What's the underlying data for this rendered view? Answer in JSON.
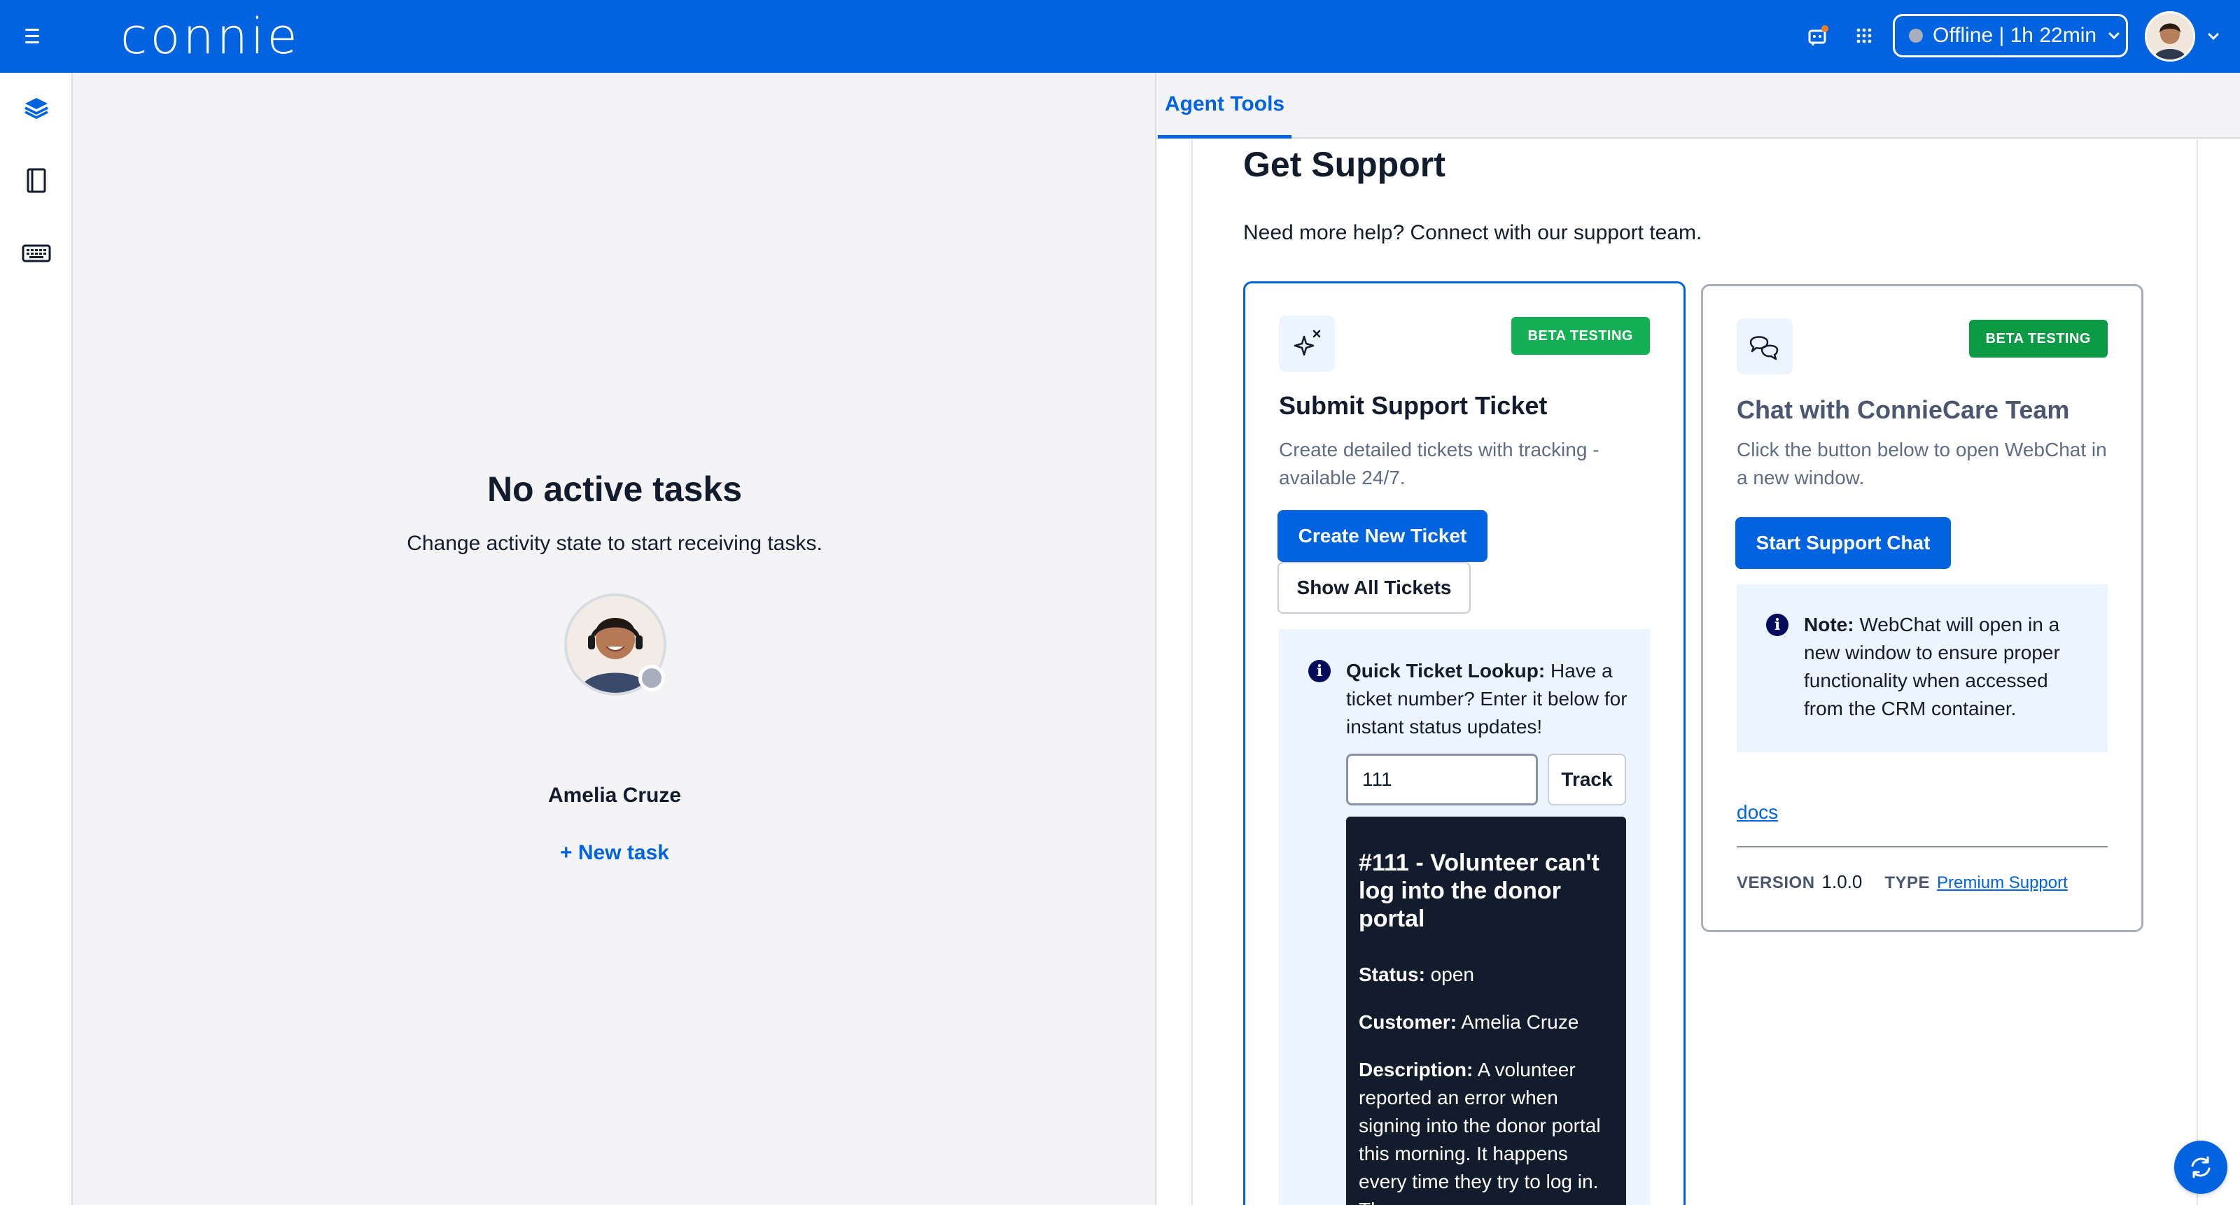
{
  "app": {
    "logo_text": "connie",
    "brand_color": "#0263e0"
  },
  "topbar": {
    "status_label": "Offline | 1h 22min",
    "icons": [
      "hamburger-icon",
      "notification-icon",
      "apps-grid-icon",
      "chevron-down-icon"
    ]
  },
  "rail": {
    "items": [
      "layers-icon",
      "notebook-icon",
      "keyboard-icon"
    ]
  },
  "center": {
    "title": "No active tasks",
    "subtitle": "Change activity state to start receiving tasks.",
    "agent_name": "Amelia Cruze",
    "new_task_label": "+ New task"
  },
  "right": {
    "tab_label": "Agent Tools",
    "page_title": "Get Support",
    "page_subtitle": "Need more help? Connect with our support team.",
    "ticket_card": {
      "badge": "BETA TESTING",
      "title": "Submit Support Ticket",
      "description": "Create detailed tickets with tracking - available 24/7.",
      "create_button": "Create New Ticket",
      "show_button": "Show All Tickets",
      "lookup_label": "Quick Ticket Lookup:",
      "lookup_text": " Have a ticket number? Enter it below for instant status updates!",
      "ticket_input_value": "111",
      "track_button": "Track",
      "result": {
        "title": "#111 - Volunteer can't log into the donor portal",
        "status_label": "Status:",
        "status_value": " open",
        "customer_label": "Customer:",
        "customer_value": " Amelia Cruze",
        "description_label": "Description:",
        "description_value": " A volunteer reported an error when signing into the donor portal this morning. It happens every time they try to log in. They"
      }
    },
    "chat_card": {
      "badge": "BETA TESTING",
      "title": "Chat with ConnieCare Team",
      "description": "Click the button below to open WebChat in a new window.",
      "start_button": "Start Support Chat",
      "note_label": "Note:",
      "note_text": " WebChat will open in a new window to ensure proper functionality when accessed from the CRM container.",
      "docs_link": "docs",
      "version_label": "VERSION",
      "version_value": "1.0.0",
      "type_label": "TYPE",
      "type_value": "Premium Support"
    }
  }
}
